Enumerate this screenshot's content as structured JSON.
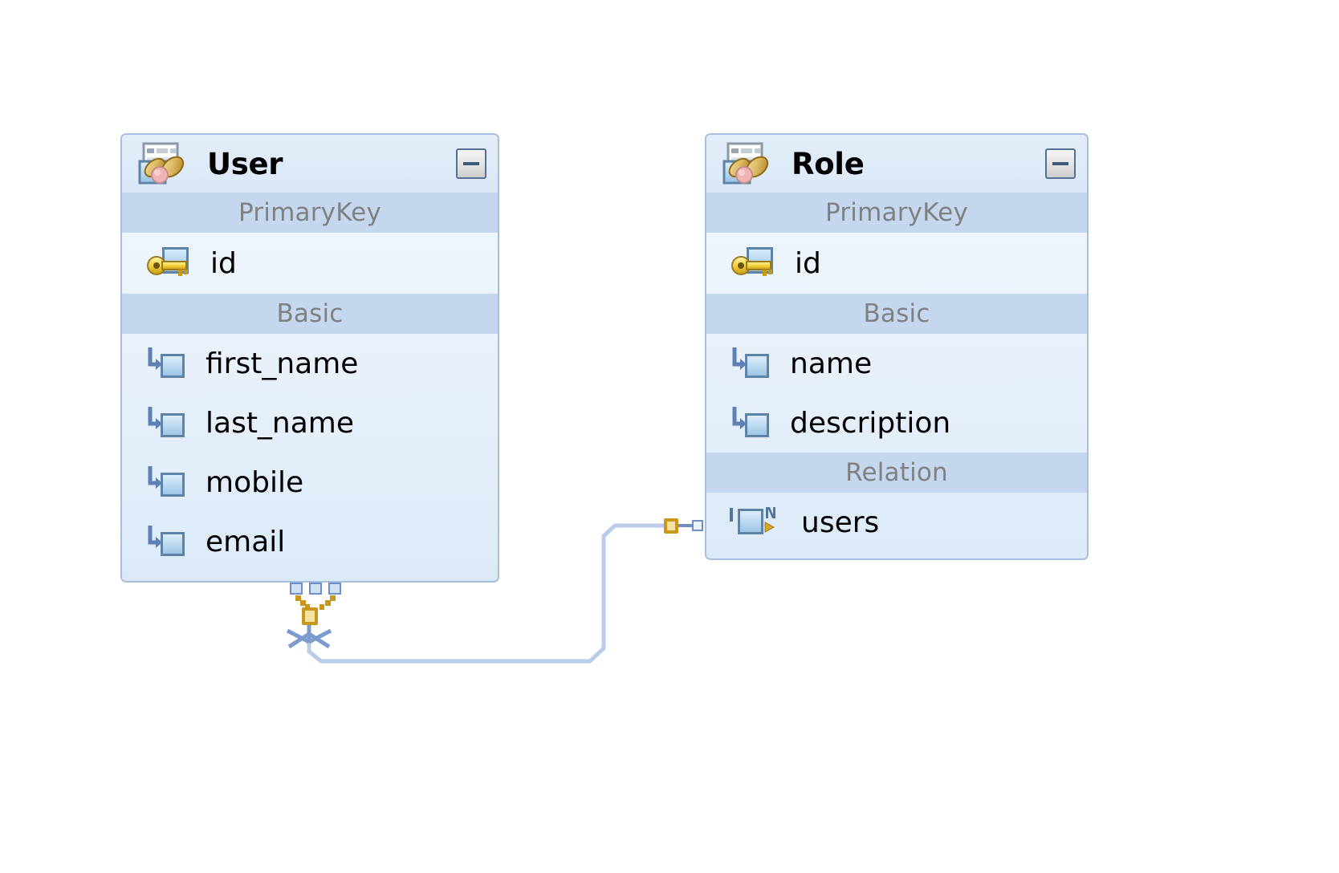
{
  "diagram": {
    "type": "entity-relationship-diagram",
    "background_color": "#ffffff",
    "connector_color": "#b9cdea",
    "connector_marker_color": "#d4a017",
    "entities": [
      {
        "name": "User",
        "icon": "entity-bean-icon",
        "collapse_control": "minus",
        "sections": [
          {
            "title": "PrimaryKey",
            "attributes": [
              {
                "name": "id",
                "icon": "primary-key-icon"
              }
            ]
          },
          {
            "title": "Basic",
            "attributes": [
              {
                "name": "first_name",
                "icon": "field-icon"
              },
              {
                "name": "last_name",
                "icon": "field-icon"
              },
              {
                "name": "mobile",
                "icon": "field-icon"
              },
              {
                "name": "email",
                "icon": "field-icon"
              }
            ]
          }
        ]
      },
      {
        "name": "Role",
        "icon": "entity-bean-icon",
        "collapse_control": "minus",
        "sections": [
          {
            "title": "PrimaryKey",
            "attributes": [
              {
                "name": "id",
                "icon": "primary-key-icon"
              }
            ]
          },
          {
            "title": "Basic",
            "attributes": [
              {
                "name": "name",
                "icon": "field-icon"
              },
              {
                "name": "description",
                "icon": "field-icon"
              }
            ]
          },
          {
            "title": "Relation",
            "attributes": [
              {
                "name": "users",
                "icon": "one-to-many-relation-icon",
                "cardinality_left": "1",
                "cardinality_right": "N"
              }
            ]
          }
        ]
      }
    ],
    "relationship": {
      "from": "User",
      "to": "Role",
      "from_cardinality": "many",
      "to_cardinality": "one",
      "from_marker": "crows-foot",
      "to_marker": "single-line"
    }
  }
}
